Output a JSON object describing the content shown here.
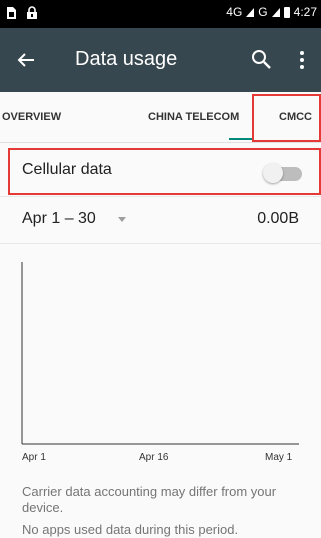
{
  "status_bar": {
    "network_1": "4G",
    "network_2": "G",
    "time": "4:27"
  },
  "app_bar": {
    "title": "Data usage",
    "back_icon": "back-arrow-icon",
    "search_icon": "search-icon",
    "more_icon": "more-vert-icon"
  },
  "tabs": [
    {
      "label": "OVERVIEW"
    },
    {
      "label": "CHINA TELECOM"
    },
    {
      "label": "CMCC",
      "selected": true
    }
  ],
  "accent_color": "#00897b",
  "cellular": {
    "label": "Cellular data",
    "toggle_on": false
  },
  "cycle": {
    "label": "Apr 1 – 30",
    "usage": "0.00B"
  },
  "chart_data": {
    "type": "line",
    "x": [
      "Apr 1",
      "Apr 16",
      "May 1"
    ],
    "series": [],
    "title": "",
    "xlabel": "",
    "ylabel": ""
  },
  "footer": {
    "note": "Carrier data accounting may differ from your device.",
    "empty": "No apps used data during this period."
  }
}
